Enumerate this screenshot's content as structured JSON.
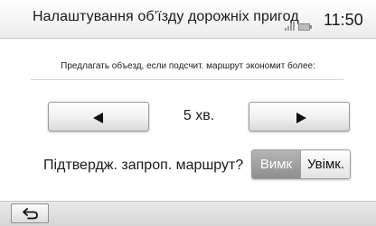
{
  "header": {
    "title": "Налаштування об’їзду дорожніх пригод",
    "clock": "11:50",
    "signal_icon": "signal-icon",
    "battery_icon": "battery-icon"
  },
  "prompt": {
    "text": "Предлагать объезд, если подсчит. маршрут экономит более:"
  },
  "stepper": {
    "decrease_icon": "arrow-left-icon",
    "increase_icon": "arrow-right-icon",
    "value": "5 хв."
  },
  "confirm": {
    "label": "Підтвердж. запроп. маршрут?",
    "options": [
      "Вимк",
      "Увімк."
    ],
    "selected": "Вимк"
  },
  "footer": {
    "back_icon": "back-arrow-icon"
  },
  "colors": {
    "selected_option_bg": "#9e9e9e",
    "button_bg": "#f0f0f0"
  }
}
